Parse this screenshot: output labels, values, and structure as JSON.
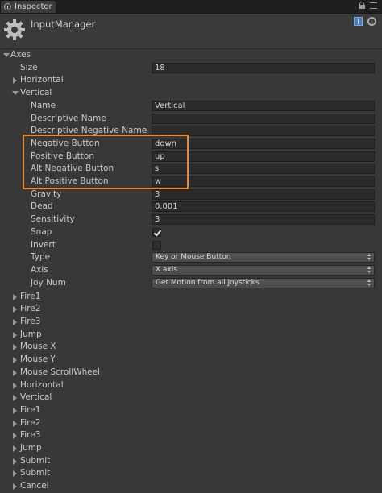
{
  "tab": {
    "label": "Inspector"
  },
  "header": {
    "title": "InputManager"
  },
  "axes": {
    "label": "Axes",
    "size_label": "Size",
    "size_value": "18"
  },
  "collapsed_before": [
    "Horizontal"
  ],
  "vertical": {
    "label": "Vertical",
    "name_label": "Name",
    "name_value": "Vertical",
    "desc_label": "Descriptive Name",
    "desc_value": "",
    "desc_neg_label": "Descriptive Negative Name",
    "desc_neg_value": "",
    "neg_label": "Negative Button",
    "neg_value": "down",
    "pos_label": "Positive Button",
    "pos_value": "up",
    "alt_neg_label": "Alt Negative Button",
    "alt_neg_value": "s",
    "alt_pos_label": "Alt Positive Button",
    "alt_pos_value": "w",
    "gravity_label": "Gravity",
    "gravity_value": "3",
    "dead_label": "Dead",
    "dead_value": "0.001",
    "sens_label": "Sensitivity",
    "sens_value": "3",
    "snap_label": "Snap",
    "snap_checked": true,
    "invert_label": "Invert",
    "invert_checked": false,
    "type_label": "Type",
    "type_value": "Key or Mouse Button",
    "axis_label": "Axis",
    "axis_value": "X axis",
    "joy_label": "Joy Num",
    "joy_value": "Get Motion from all Joysticks"
  },
  "collapsed_after": [
    "Fire1",
    "Fire2",
    "Fire3",
    "Jump",
    "Mouse X",
    "Mouse Y",
    "Mouse ScrollWheel",
    "Horizontal",
    "Vertical",
    "Fire1",
    "Fire2",
    "Fire3",
    "Jump",
    "Submit",
    "Submit",
    "Cancel"
  ],
  "colors": {
    "highlight": "#e88a2d",
    "background": "#383838"
  },
  "icons": [
    "info-icon",
    "lock-icon",
    "menu-icon",
    "gear-icon",
    "book-icon",
    "gear-small-icon"
  ]
}
